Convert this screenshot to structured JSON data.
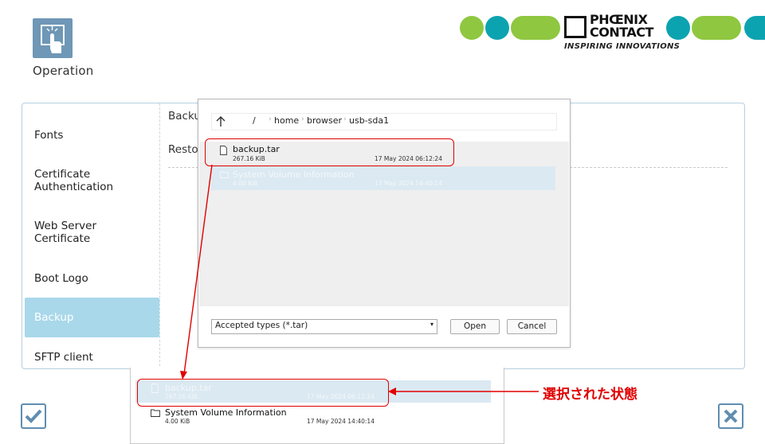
{
  "header": {
    "section_title": "Operation",
    "section_icon": "touch-hand-icon",
    "brand": {
      "line1": "PHŒNIX",
      "line2": "CONTACT",
      "tagline": "INSPIRING INNOVATIONS",
      "colors": {
        "green": "#8fc740",
        "teal": "#0ca3b0"
      }
    }
  },
  "sidebar": {
    "items": [
      {
        "label": "Fonts"
      },
      {
        "label": "Certificate\nAuthentication"
      },
      {
        "label": "Web Server\nCertificate"
      },
      {
        "label": "Boot Logo"
      },
      {
        "label": "Backup",
        "active": true
      },
      {
        "label": "SFTP client"
      }
    ],
    "active_color": "#a9d8ea"
  },
  "content": {
    "backup_label_partial": "Backu",
    "restore_label_partial": "Restor"
  },
  "dialog": {
    "up_icon": "arrow-up-icon",
    "breadcrumb": [
      "/",
      "home",
      "browser",
      "usb-sda1"
    ],
    "files": [
      {
        "name": "backup.tar",
        "size": "267.16 KiB",
        "date": "17 May 2024 06:12:24",
        "icon": "file-icon"
      },
      {
        "name": "System Volume Information",
        "size": "4.00 KiB",
        "date": "17 May 2024 14:40:14",
        "icon": "folder-icon"
      }
    ],
    "filter": "Accepted types (*.tar)",
    "open_button": "Open",
    "cancel_button": "Cancel"
  },
  "zoom_view": {
    "files": [
      {
        "name": "backup.tar",
        "size": "267.16 KiB",
        "date": "17 May 2024 06:12:24",
        "selected": true
      },
      {
        "name": "System Volume Information",
        "size": "4.00 KiB",
        "date": "17 May 2024 14:40:14"
      }
    ]
  },
  "annotation": {
    "text": "選択された状態",
    "color": "#e00000"
  },
  "footer": {
    "confirm_icon": "check-icon",
    "close_icon": "close-x-icon"
  }
}
